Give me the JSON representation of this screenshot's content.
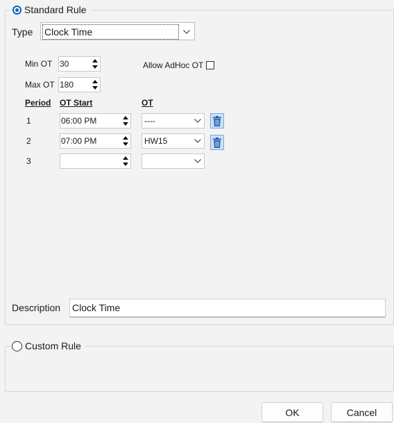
{
  "standard_rule": {
    "label": "Standard Rule",
    "selected": true,
    "type_label": "Type",
    "type_value": "Clock Time",
    "min_ot_label": "Min OT",
    "min_ot_value": "30",
    "max_ot_label": "Max OT",
    "max_ot_value": "180",
    "allow_adhoc_label": "Allow AdHoc OT",
    "allow_adhoc_checked": false,
    "headers": {
      "period": "Period",
      "ot_start": "OT Start",
      "ot": "OT"
    },
    "rows": [
      {
        "period": "1",
        "ot_start": "06:00 PM",
        "ot": "----",
        "has_delete": true
      },
      {
        "period": "2",
        "ot_start": "07:00 PM",
        "ot": "HW15",
        "has_delete": true
      },
      {
        "period": "3",
        "ot_start": "",
        "ot": "",
        "has_delete": false
      }
    ],
    "description_label": "Description",
    "description_value": "Clock Time"
  },
  "custom_rule": {
    "label": "Custom Rule",
    "selected": false
  },
  "buttons": {
    "ok": "OK",
    "cancel": "Cancel"
  },
  "colors": {
    "accent": "#0067c0",
    "background": "#f3f3f3",
    "trash_fill": "#cfe0f5",
    "trash_icon": "#1f5fb0"
  }
}
